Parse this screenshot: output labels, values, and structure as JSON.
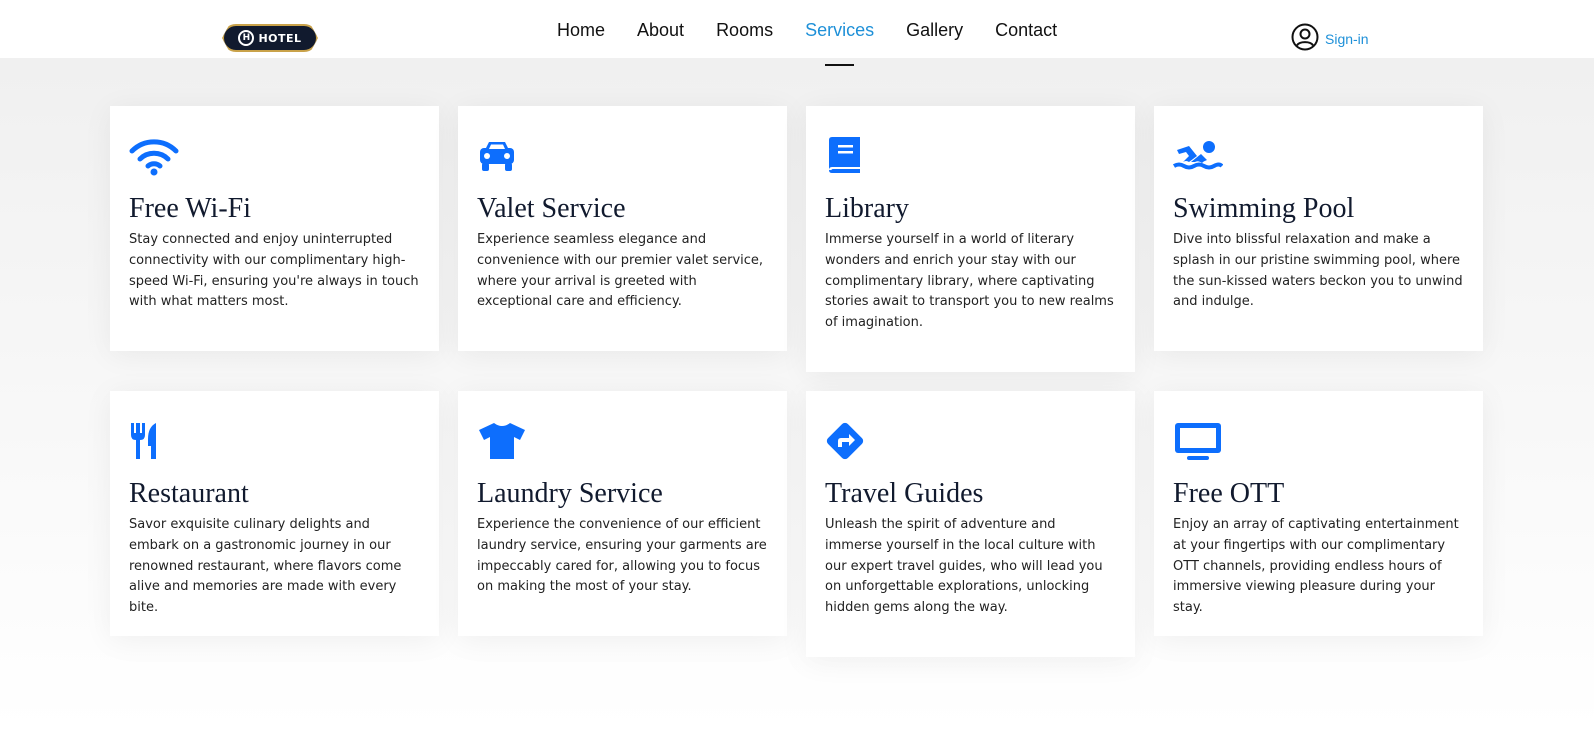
{
  "header": {
    "logo_text": "HOTEL",
    "logo_badge": "H",
    "nav": [
      {
        "label": "Home",
        "active": false
      },
      {
        "label": "About",
        "active": false
      },
      {
        "label": "Rooms",
        "active": false
      },
      {
        "label": "Services",
        "active": true
      },
      {
        "label": "Gallery",
        "active": false
      },
      {
        "label": "Contact",
        "active": false
      }
    ],
    "signin_label": "Sign-in"
  },
  "colors": {
    "accent": "#1e90d8",
    "icon_blue": "#0d6efd",
    "heading": "#111a2e",
    "logo_bg": "#111a2e",
    "logo_border": "#c9a24a"
  },
  "services": [
    {
      "icon": "wifi-icon",
      "title": "Free Wi-Fi",
      "text": "Stay connected and enjoy uninterrupted connectivity with our complimentary high-speed Wi-Fi, ensuring you're always in touch with what matters most."
    },
    {
      "icon": "car-icon",
      "title": "Valet Service",
      "text": "Experience seamless elegance and convenience with our premier valet service, where your arrival is greeted with exceptional care and efficiency."
    },
    {
      "icon": "book-icon",
      "title": "Library",
      "text": "Immerse yourself in a world of literary wonders and enrich your stay with our complimentary library, where captivating stories await to transport you to new realms of imagination."
    },
    {
      "icon": "swimmer-icon",
      "title": "Swimming Pool",
      "text": "Dive into blissful relaxation and make a splash in our pristine swimming pool, where the sun-kissed waters beckon you to unwind and indulge."
    },
    {
      "icon": "utensils-icon",
      "title": "Restaurant",
      "text": "Savor exquisite culinary delights and embark on a gastronomic journey in our renowned restaurant, where flavors come alive and memories are made with every bite."
    },
    {
      "icon": "tshirt-icon",
      "title": "Laundry Service",
      "text": "Experience the convenience of our efficient laundry service, ensuring your garments are impeccably cared for, allowing you to focus on making the most of your stay."
    },
    {
      "icon": "directions-icon",
      "title": "Travel Guides",
      "text": "Unleash the spirit of adventure and immerse yourself in the local culture with our expert travel guides, who will lead you on unforgettable explorations, unlocking hidden gems along the way."
    },
    {
      "icon": "tv-icon",
      "title": "Free OTT",
      "text": "Enjoy an array of captivating entertainment at your fingertips with our complimentary OTT channels, providing endless hours of immersive viewing pleasure during your stay."
    }
  ]
}
